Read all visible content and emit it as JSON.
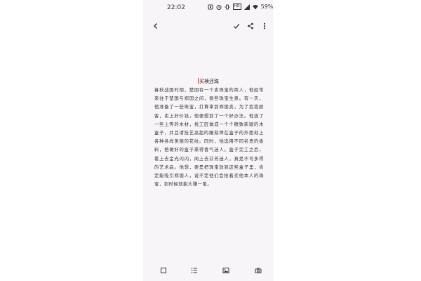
{
  "status_bar": {
    "time": "22:02",
    "hd_label": "HD",
    "battery_text": "59%",
    "icons": [
      "notification-icon",
      "alarm-icon",
      "vibrate-icon",
      "hd-icon",
      "signal-icon",
      "wifi-icon",
      "battery-icon"
    ]
  },
  "app_bar": {
    "icons": [
      "back-arrow-icon",
      "checkmark-icon",
      "share-icon",
      "more-vertical-icon"
    ]
  },
  "document": {
    "title": "买椟还珠",
    "body": "春秋战国时期，楚国有一个卖珠宝的商人，他经常来往于楚国与郑国之间，倒些珠宝生意。有一天，他准备了一些珠宝，打算拿到郑国卖，为了招揽顾客，卖上好价钱，他便想到了一个好办法。他选了一些上等的木材，找工匠做成一个个精致新颖的木盒子，并且请技艺高超的雕刻师在盒子的外面刻上各种各样美丽的花纹。同时，他选用不同名贵的香料，把做好的盒子熏得香气迷人。盒子完工之后，看上去金光闪闪，闻上去芬芳迷人，真是不可多得的艺术品。他想，要是把珠宝放到这些盒子里，肯定能吸引郑国人，说不定他们会抢着买他本人的珠宝，到时候就能大赚一笔。"
  },
  "bottom_bar": {
    "icons": [
      "checkbox-icon",
      "bullet-list-icon",
      "image-icon",
      "camera-icon"
    ]
  },
  "colors": {
    "background": "#f7f5f8",
    "text": "#333333",
    "cursor": "#d03030"
  }
}
